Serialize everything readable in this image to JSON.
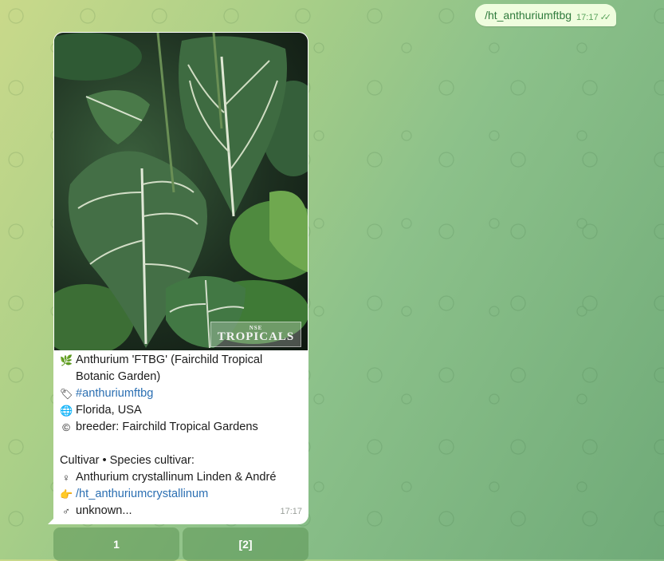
{
  "outgoing": {
    "text": "/ht_anthuriumftbg",
    "time": "17:17"
  },
  "incoming": {
    "photo_watermark_small": "NSE",
    "photo_watermark_big": "TROPICALS",
    "title": "Anthurium 'FTBG' (Fairchild Tropical Botanic Garden)",
    "hashtag": "#anthuriumftbg",
    "location": "Florida, USA",
    "breeder": "breeder: Fairchild Tropical Gardens",
    "cultivar_heading": "Cultivar • Species cultivar:",
    "species": "Anthurium crystallinum Linden & André",
    "species_command": "/ht_anthuriumcrystallinum",
    "parent2": "unknown...",
    "time": "17:17"
  },
  "keyboard": {
    "buttons": [
      "1",
      "[2]"
    ]
  },
  "icons": {
    "title": "herb-icon",
    "hashtag": "tag-icon",
    "location": "globe-icon",
    "breeder": "copyright-icon",
    "species": "female-sign-icon",
    "species_command": "pointing-hand-icon",
    "parent2": "male-sign-icon"
  }
}
